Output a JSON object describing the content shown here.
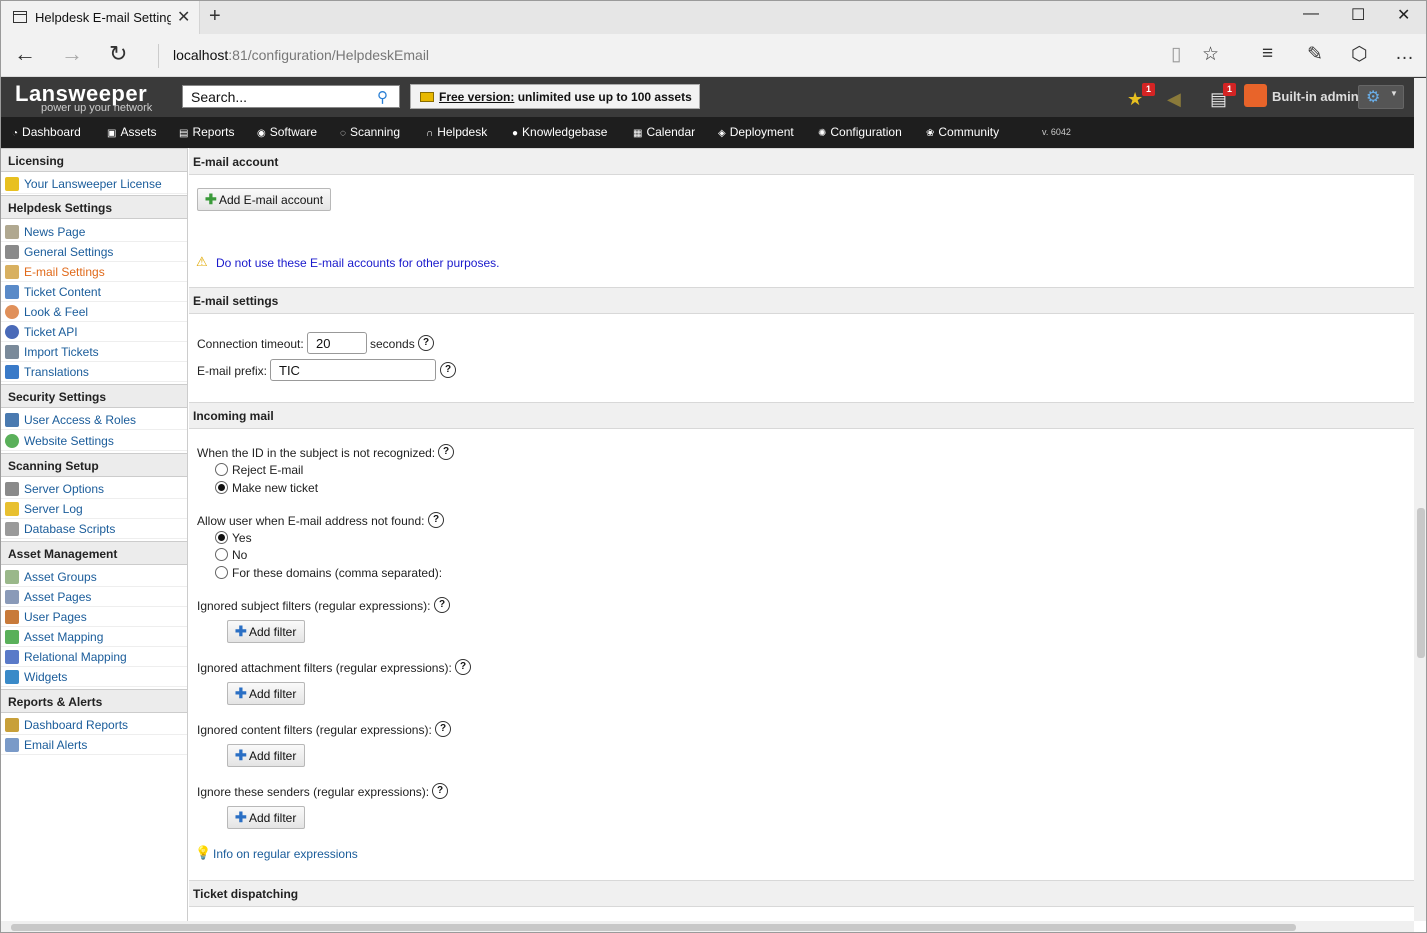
{
  "browser": {
    "tab_title": "Helpdesk E-mail Settings",
    "url_host": "localhost",
    "url_path": ":81/configuration/HelpdeskEmail"
  },
  "header": {
    "logo": "Lansweeper",
    "tagline": "power up your network",
    "search_value": "Search...",
    "free_link": "Free version:",
    "free_text": " unlimited use up to 100 assets",
    "badge_favorites": "1",
    "badge_calendar": "1",
    "user_name": "Built-in admin"
  },
  "nav": {
    "items": [
      {
        "label": "Dashboard",
        "icon": "dashboard-icon"
      },
      {
        "label": "Assets",
        "icon": "assets-icon"
      },
      {
        "label": "Reports",
        "icon": "reports-icon"
      },
      {
        "label": "Software",
        "icon": "software-icon"
      },
      {
        "label": "Scanning",
        "icon": "scanning-icon"
      },
      {
        "label": "Helpdesk",
        "icon": "headset-icon"
      },
      {
        "label": "Knowledgebase",
        "icon": "info-icon"
      },
      {
        "label": "Calendar",
        "icon": "calendar-icon"
      },
      {
        "label": "Deployment",
        "icon": "deployment-icon"
      },
      {
        "label": "Configuration",
        "icon": "gear-icon"
      },
      {
        "label": "Community",
        "icon": "community-icon"
      }
    ],
    "version": "v. 6042"
  },
  "sidebar": {
    "sections": [
      {
        "title": "Licensing",
        "items": [
          "Your Lansweeper License"
        ]
      },
      {
        "title": "Helpdesk Settings",
        "items": [
          "News Page",
          "General Settings",
          "E-mail Settings",
          "Ticket Content",
          "Look & Feel",
          "Ticket API",
          "Import Tickets",
          "Translations"
        ]
      },
      {
        "title": "Security Settings",
        "items": [
          "User Access & Roles",
          "Website Settings"
        ]
      },
      {
        "title": "Scanning Setup",
        "items": [
          "Server Options",
          "Server Log",
          "Database Scripts"
        ]
      },
      {
        "title": "Asset Management",
        "items": [
          "Asset Groups",
          "Asset Pages",
          "User Pages",
          "Asset Mapping",
          "Relational Mapping",
          "Widgets"
        ]
      },
      {
        "title": "Reports & Alerts",
        "items": [
          "Dashboard Reports",
          "Email Alerts"
        ]
      }
    ],
    "active_item": "E-mail Settings"
  },
  "content": {
    "email_account": {
      "title": "E-mail account",
      "add_button": "Add E-mail account",
      "warning": "Do not use these E-mail accounts for other purposes."
    },
    "email_settings": {
      "title": "E-mail settings",
      "timeout_label": "Connection timeout:",
      "timeout_value": "20",
      "timeout_unit": "seconds",
      "prefix_label": "E-mail prefix:",
      "prefix_value": "TIC"
    },
    "incoming": {
      "title": "Incoming mail",
      "id_label": "When the ID in the subject is not recognized:",
      "id_options": [
        "Reject E-mail",
        "Make new ticket"
      ],
      "id_selected": "Make new ticket",
      "allow_label": "Allow user when E-mail address not found:",
      "allow_options": [
        "Yes",
        "No",
        "For these domains (comma separated):"
      ],
      "allow_selected": "Yes",
      "subject_filters": "Ignored subject filters (regular expressions):",
      "attachment_filters": "Ignored attachment filters (regular expressions):",
      "content_filters": "Ignored content filters (regular expressions):",
      "sender_filters": "Ignore these senders (regular expressions):",
      "add_filter": "Add filter",
      "info_link": "Info on regular expressions"
    },
    "dispatching": {
      "title": "Ticket dispatching"
    }
  }
}
